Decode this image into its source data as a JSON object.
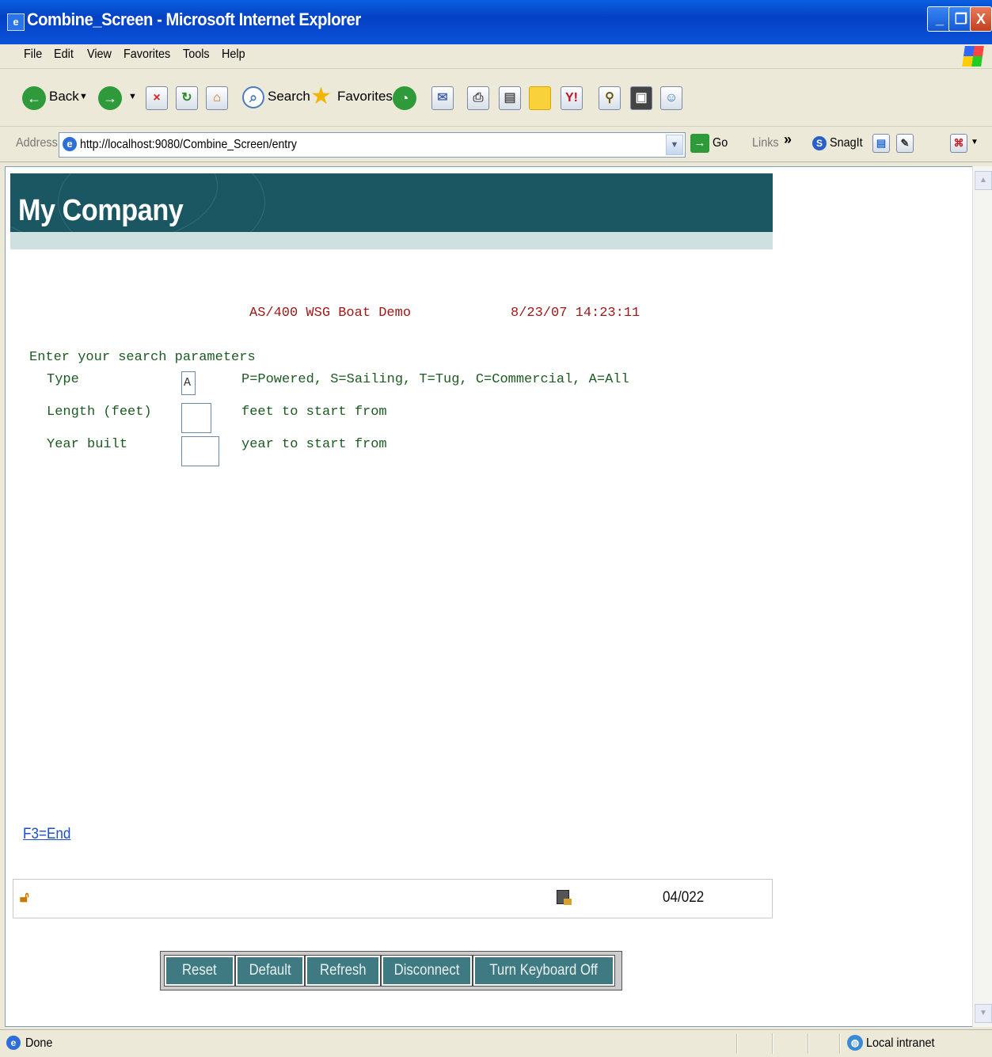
{
  "window": {
    "title": "Combine_Screen - Microsoft Internet Explorer",
    "controls": {
      "minimize": "_",
      "maximize": "❐",
      "close": "X"
    }
  },
  "menu": [
    "File",
    "Edit",
    "View",
    "Favorites",
    "Tools",
    "Help"
  ],
  "toolbar": {
    "back_label": "Back",
    "search_label": "Search",
    "favorites_label": "Favorites"
  },
  "address": {
    "label": "Address",
    "url": "http://localhost:9080/Combine_Screen/entry",
    "go_label": "Go",
    "links_label": "Links",
    "snagit_label": "SnagIt"
  },
  "page": {
    "company": "My Company",
    "app_title": "AS/400 WSG Boat Demo",
    "datetime": "8/23/07 14:23:11",
    "prompt": "Enter your search parameters",
    "fields": [
      {
        "label": "Type",
        "value": "A",
        "hint": "P=Powered, S=Sailing, T=Tug, C=Commercial, A=All"
      },
      {
        "label": "Length (feet)",
        "value": "",
        "hint": "feet to start from"
      },
      {
        "label": "Year built",
        "value": "",
        "hint": "year to start from"
      }
    ],
    "f3_link": "F3=End",
    "cursor_position": "04/022",
    "buttons": [
      "Reset",
      "Default",
      "Refresh",
      "Disconnect",
      "Turn Keyboard Off"
    ]
  },
  "status": {
    "text": "Done",
    "zone": "Local intranet"
  },
  "colors": {
    "banner": "#1a5762",
    "button": "#3f7a82",
    "screen_red": "#a01818",
    "screen_green": "#1c5a22",
    "link": "#1a4fd0"
  }
}
